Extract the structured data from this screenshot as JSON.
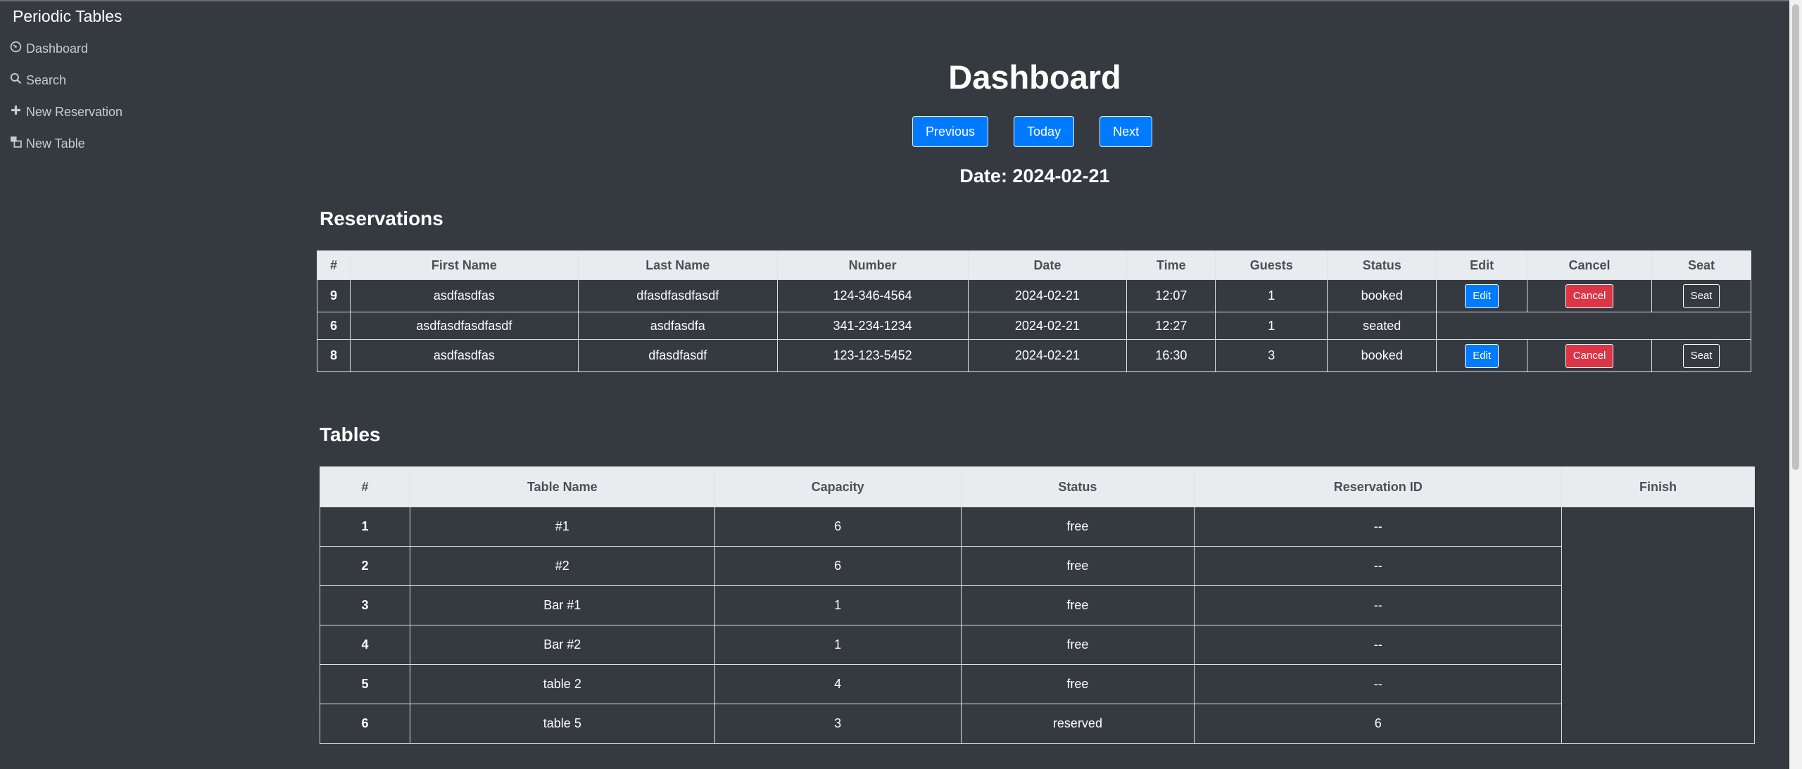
{
  "app": {
    "brand": "Periodic Tables"
  },
  "sidebar": {
    "items": [
      {
        "label": "Dashboard",
        "icon": "dashboard-icon"
      },
      {
        "label": "Search",
        "icon": "search-icon"
      },
      {
        "label": "New Reservation",
        "icon": "plus-icon"
      },
      {
        "label": "New Table",
        "icon": "table-icon"
      }
    ]
  },
  "page": {
    "title": "Dashboard",
    "nav": {
      "previous": "Previous",
      "today": "Today",
      "next": "Next"
    },
    "date_label": "Date: 2024-02-21"
  },
  "reservations": {
    "title": "Reservations",
    "headers": [
      "#",
      "First Name",
      "Last Name",
      "Number",
      "Date",
      "Time",
      "Guests",
      "Status",
      "Edit",
      "Cancel",
      "Seat"
    ],
    "rows": [
      {
        "id": "9",
        "first": "asdfasdfas",
        "last": "dfasdfasdfasdf",
        "number": "124-346-4564",
        "date": "2024-02-21",
        "time": "12:07",
        "guests": "1",
        "status": "booked",
        "edit": "Edit",
        "cancel": "Cancel",
        "seat": "Seat"
      },
      {
        "id": "6",
        "first": "asdfasdfasdfasdf",
        "last": "asdfasdfa",
        "number": "341-234-1234",
        "date": "2024-02-21",
        "time": "12:27",
        "guests": "1",
        "status": "seated"
      },
      {
        "id": "8",
        "first": "asdfasdfas",
        "last": "dfasdfasdf",
        "number": "123-123-5452",
        "date": "2024-02-21",
        "time": "16:30",
        "guests": "3",
        "status": "booked",
        "edit": "Edit",
        "cancel": "Cancel",
        "seat": "Seat"
      }
    ]
  },
  "tables": {
    "title": "Tables",
    "headers": [
      "#",
      "Table Name",
      "Capacity",
      "Status",
      "Reservation ID",
      "Finish"
    ],
    "rows": [
      {
        "id": "1",
        "name": "#1",
        "capacity": "6",
        "status": "free",
        "reservation_id": "--"
      },
      {
        "id": "2",
        "name": "#2",
        "capacity": "6",
        "status": "free",
        "reservation_id": "--"
      },
      {
        "id": "3",
        "name": "Bar #1",
        "capacity": "1",
        "status": "free",
        "reservation_id": "--"
      },
      {
        "id": "4",
        "name": "Bar #2",
        "capacity": "1",
        "status": "free",
        "reservation_id": "--"
      },
      {
        "id": "5",
        "name": "table 2",
        "capacity": "4",
        "status": "free",
        "reservation_id": "--"
      },
      {
        "id": "6",
        "name": "table 5",
        "capacity": "3",
        "status": "reserved",
        "reservation_id": "6"
      }
    ]
  },
  "colors": {
    "background": "#343a40",
    "primary": "#007bff",
    "danger": "#dc3545",
    "header_bg": "#e9ecef"
  }
}
